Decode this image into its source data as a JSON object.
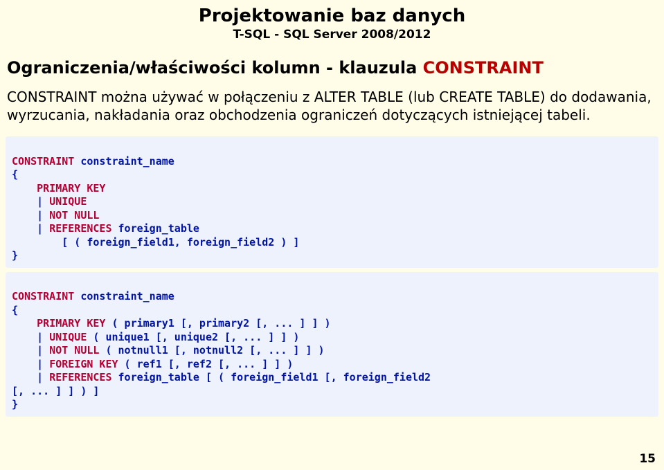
{
  "header": {
    "title": "Projektowanie baz danych",
    "subtitle": "T-SQL - SQL Server 2008/2012"
  },
  "section": {
    "heading_black": "Ograniczenia/właściwości kolumn - klauzula ",
    "heading_red": "CONSTRAINT",
    "paragraph": "CONSTRAINT można używać w połączeniu z ALTER TABLE (lub CREATE TABLE) do dodawania, wyrzucania, nakładania oraz obchodzenia ograniczeń dotyczących istniejącej tabeli."
  },
  "code1": {
    "l1": {
      "kw": "CONSTRAINT ",
      "rest": "constraint_name"
    },
    "l2": "{",
    "l3": {
      "pre": "    ",
      "kw": "PRIMARY KEY"
    },
    "l4": {
      "pre": "    | ",
      "kw": "UNIQUE"
    },
    "l5": {
      "pre": "    | ",
      "kw": "NOT NULL"
    },
    "l6": {
      "pre": "    | ",
      "kw": "REFERENCES",
      "rest": " foreign_table"
    },
    "l7": "        [ ( foreign_field1, foreign_field2 ) ]",
    "l8": "}"
  },
  "code2": {
    "l1": {
      "kw": "CONSTRAINT ",
      "rest": "constraint_name"
    },
    "l2": "{",
    "l3": {
      "pre": "    ",
      "kw": "PRIMARY KEY",
      "rest": " ( primary1 [, primary2 [, ... ] ] )"
    },
    "l4": {
      "pre": "    | ",
      "kw": "UNIQUE",
      "rest": " ( unique1 [, unique2 [, ... ] ] )"
    },
    "l5": {
      "pre": "    | ",
      "kw": "NOT NULL",
      "rest": " ( notnull1 [, notnull2 [, ... ] ] )"
    },
    "l6": {
      "pre": "    | ",
      "kw": "FOREIGN KEY",
      "rest": " ( ref1 [, ref2 [, ... ] ] )"
    },
    "l7": {
      "pre": "    | ",
      "kw": "REFERENCES",
      "rest": " foreign_table [ ( foreign_field1 [, foreign_field2"
    },
    "l8": "[, ... ] ] ) ]",
    "l9": "}"
  },
  "page_number": "15"
}
